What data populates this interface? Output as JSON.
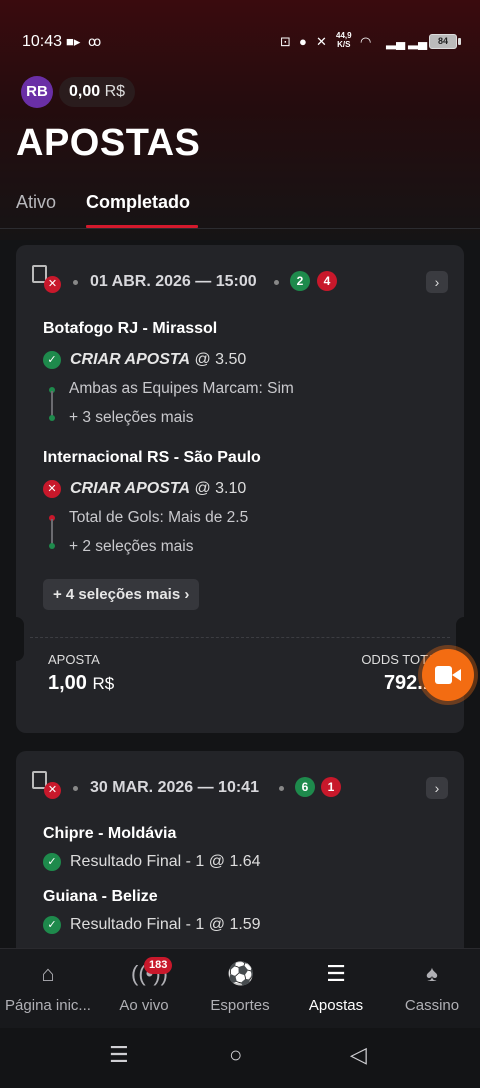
{
  "status_bar": {
    "time": "10:43",
    "net_speed_top": "44,9",
    "net_speed_bottom": "K/S",
    "battery": "84"
  },
  "header": {
    "avatar": "RB",
    "balance_value": "0,00",
    "balance_currency": "R$",
    "title": "APOSTAS",
    "tabs": [
      {
        "label": "Ativo",
        "active": false
      },
      {
        "label": "Completado",
        "active": true
      }
    ]
  },
  "bets": [
    {
      "date": "01 ABR. 2026 — 15:00",
      "won": "2",
      "lost": "4",
      "matches": [
        {
          "name": "Botafogo RJ - Mirassol",
          "result": "win",
          "market": "CRIAR APOSTA",
          "odd": "@ 3.50",
          "detail": "Ambas as Equipes Marcam: Sim",
          "more": "+ 3 seleções mais"
        },
        {
          "name": "Internacional RS - São Paulo",
          "result": "loss",
          "market": "CRIAR APOSTA",
          "odd": "@ 3.10",
          "detail": "Total de Gols: Mais de 2.5",
          "more": "+ 2 seleções mais"
        }
      ],
      "more_button": "+ 4 seleções mais",
      "stake_label": "APOSTA",
      "stake_value": "1,00",
      "stake_currency": "R$",
      "odds_label": "ODDS TOTAIS",
      "odds_value": "792.1"
    },
    {
      "date": "30 MAR. 2026 — 10:41",
      "won": "6",
      "lost": "1",
      "matches": [
        {
          "name": "Chipre - Moldávia",
          "result": "win",
          "selection": "Resultado Final - 1",
          "odd": "@ 1.64"
        },
        {
          "name": "Guiana - Belize",
          "result": "win",
          "selection": "Resultado Final - 1",
          "odd": "@ 1.59"
        }
      ]
    }
  ],
  "bottom_nav": [
    {
      "label": "Página inic...",
      "icon": "home-icon"
    },
    {
      "label": "Ao vivo",
      "icon": "live-icon",
      "badge": "183"
    },
    {
      "label": "Esportes",
      "icon": "soccer-ball-icon"
    },
    {
      "label": "Apostas",
      "icon": "receipt-icon",
      "active": true
    },
    {
      "label": "Cassino",
      "icon": "cards-icon"
    }
  ],
  "colors": {
    "accent": "#d3192c",
    "win": "#1e8a4c",
    "loss": "#c8182b",
    "fab": "#f36c12"
  }
}
